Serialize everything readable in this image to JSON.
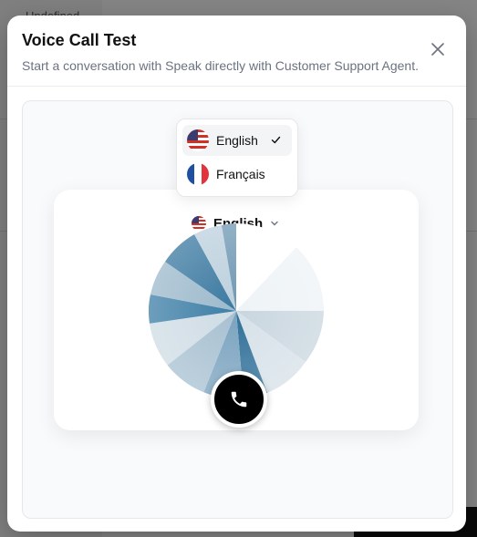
{
  "background": {
    "top_left_text": "Undefined"
  },
  "modal": {
    "title": "Voice Call Test",
    "subtitle": "Start a conversation with Speak directly with Customer Support Agent.",
    "close_icon": "close-icon"
  },
  "call_card": {
    "selected_language": "English",
    "call_icon": "phone-icon"
  },
  "language_dropdown": {
    "items": [
      {
        "label": "English",
        "flag": "us-flag-icon",
        "selected": true
      },
      {
        "label": "Français",
        "flag": "fr-flag-icon",
        "selected": false
      }
    ]
  },
  "colors": {
    "orb_primary": "#2f6f98",
    "call_button": "#000000"
  }
}
